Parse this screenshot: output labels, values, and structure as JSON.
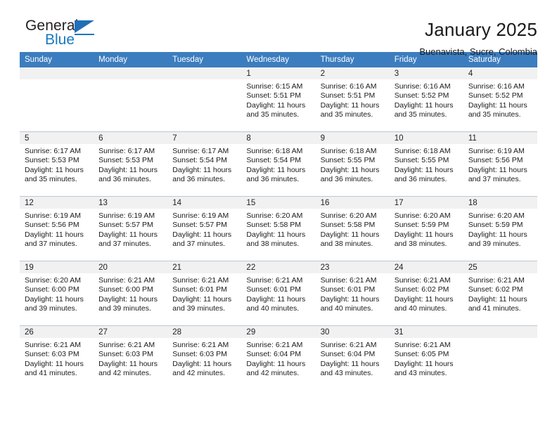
{
  "brand": {
    "name_line1": "General",
    "name_line2": "Blue",
    "triangle_color": "#1f6fb8",
    "blue_color": "#1878be"
  },
  "header": {
    "title": "January 2025",
    "subtitle": "Buenavista, Sucre, Colombia"
  },
  "theme": {
    "header_blue": "#3c7dbf",
    "daynum_bg": "#f1f1f1",
    "grid_line": "#b9c8d6"
  },
  "weekday_headers": [
    "Sunday",
    "Monday",
    "Tuesday",
    "Wednesday",
    "Thursday",
    "Friday",
    "Saturday"
  ],
  "weeks": [
    [
      {
        "day": "",
        "sunrise": "",
        "sunset": "",
        "daylight": "",
        "daylight2": ""
      },
      {
        "day": "",
        "sunrise": "",
        "sunset": "",
        "daylight": "",
        "daylight2": ""
      },
      {
        "day": "",
        "sunrise": "",
        "sunset": "",
        "daylight": "",
        "daylight2": ""
      },
      {
        "day": "1",
        "sunrise": "Sunrise: 6:15 AM",
        "sunset": "Sunset: 5:51 PM",
        "daylight": "Daylight: 11 hours",
        "daylight2": "and 35 minutes."
      },
      {
        "day": "2",
        "sunrise": "Sunrise: 6:16 AM",
        "sunset": "Sunset: 5:51 PM",
        "daylight": "Daylight: 11 hours",
        "daylight2": "and 35 minutes."
      },
      {
        "day": "3",
        "sunrise": "Sunrise: 6:16 AM",
        "sunset": "Sunset: 5:52 PM",
        "daylight": "Daylight: 11 hours",
        "daylight2": "and 35 minutes."
      },
      {
        "day": "4",
        "sunrise": "Sunrise: 6:16 AM",
        "sunset": "Sunset: 5:52 PM",
        "daylight": "Daylight: 11 hours",
        "daylight2": "and 35 minutes."
      }
    ],
    [
      {
        "day": "5",
        "sunrise": "Sunrise: 6:17 AM",
        "sunset": "Sunset: 5:53 PM",
        "daylight": "Daylight: 11 hours",
        "daylight2": "and 35 minutes."
      },
      {
        "day": "6",
        "sunrise": "Sunrise: 6:17 AM",
        "sunset": "Sunset: 5:53 PM",
        "daylight": "Daylight: 11 hours",
        "daylight2": "and 36 minutes."
      },
      {
        "day": "7",
        "sunrise": "Sunrise: 6:17 AM",
        "sunset": "Sunset: 5:54 PM",
        "daylight": "Daylight: 11 hours",
        "daylight2": "and 36 minutes."
      },
      {
        "day": "8",
        "sunrise": "Sunrise: 6:18 AM",
        "sunset": "Sunset: 5:54 PM",
        "daylight": "Daylight: 11 hours",
        "daylight2": "and 36 minutes."
      },
      {
        "day": "9",
        "sunrise": "Sunrise: 6:18 AM",
        "sunset": "Sunset: 5:55 PM",
        "daylight": "Daylight: 11 hours",
        "daylight2": "and 36 minutes."
      },
      {
        "day": "10",
        "sunrise": "Sunrise: 6:18 AM",
        "sunset": "Sunset: 5:55 PM",
        "daylight": "Daylight: 11 hours",
        "daylight2": "and 36 minutes."
      },
      {
        "day": "11",
        "sunrise": "Sunrise: 6:19 AM",
        "sunset": "Sunset: 5:56 PM",
        "daylight": "Daylight: 11 hours",
        "daylight2": "and 37 minutes."
      }
    ],
    [
      {
        "day": "12",
        "sunrise": "Sunrise: 6:19 AM",
        "sunset": "Sunset: 5:56 PM",
        "daylight": "Daylight: 11 hours",
        "daylight2": "and 37 minutes."
      },
      {
        "day": "13",
        "sunrise": "Sunrise: 6:19 AM",
        "sunset": "Sunset: 5:57 PM",
        "daylight": "Daylight: 11 hours",
        "daylight2": "and 37 minutes."
      },
      {
        "day": "14",
        "sunrise": "Sunrise: 6:19 AM",
        "sunset": "Sunset: 5:57 PM",
        "daylight": "Daylight: 11 hours",
        "daylight2": "and 37 minutes."
      },
      {
        "day": "15",
        "sunrise": "Sunrise: 6:20 AM",
        "sunset": "Sunset: 5:58 PM",
        "daylight": "Daylight: 11 hours",
        "daylight2": "and 38 minutes."
      },
      {
        "day": "16",
        "sunrise": "Sunrise: 6:20 AM",
        "sunset": "Sunset: 5:58 PM",
        "daylight": "Daylight: 11 hours",
        "daylight2": "and 38 minutes."
      },
      {
        "day": "17",
        "sunrise": "Sunrise: 6:20 AM",
        "sunset": "Sunset: 5:59 PM",
        "daylight": "Daylight: 11 hours",
        "daylight2": "and 38 minutes."
      },
      {
        "day": "18",
        "sunrise": "Sunrise: 6:20 AM",
        "sunset": "Sunset: 5:59 PM",
        "daylight": "Daylight: 11 hours",
        "daylight2": "and 39 minutes."
      }
    ],
    [
      {
        "day": "19",
        "sunrise": "Sunrise: 6:20 AM",
        "sunset": "Sunset: 6:00 PM",
        "daylight": "Daylight: 11 hours",
        "daylight2": "and 39 minutes."
      },
      {
        "day": "20",
        "sunrise": "Sunrise: 6:21 AM",
        "sunset": "Sunset: 6:00 PM",
        "daylight": "Daylight: 11 hours",
        "daylight2": "and 39 minutes."
      },
      {
        "day": "21",
        "sunrise": "Sunrise: 6:21 AM",
        "sunset": "Sunset: 6:01 PM",
        "daylight": "Daylight: 11 hours",
        "daylight2": "and 39 minutes."
      },
      {
        "day": "22",
        "sunrise": "Sunrise: 6:21 AM",
        "sunset": "Sunset: 6:01 PM",
        "daylight": "Daylight: 11 hours",
        "daylight2": "and 40 minutes."
      },
      {
        "day": "23",
        "sunrise": "Sunrise: 6:21 AM",
        "sunset": "Sunset: 6:01 PM",
        "daylight": "Daylight: 11 hours",
        "daylight2": "and 40 minutes."
      },
      {
        "day": "24",
        "sunrise": "Sunrise: 6:21 AM",
        "sunset": "Sunset: 6:02 PM",
        "daylight": "Daylight: 11 hours",
        "daylight2": "and 40 minutes."
      },
      {
        "day": "25",
        "sunrise": "Sunrise: 6:21 AM",
        "sunset": "Sunset: 6:02 PM",
        "daylight": "Daylight: 11 hours",
        "daylight2": "and 41 minutes."
      }
    ],
    [
      {
        "day": "26",
        "sunrise": "Sunrise: 6:21 AM",
        "sunset": "Sunset: 6:03 PM",
        "daylight": "Daylight: 11 hours",
        "daylight2": "and 41 minutes."
      },
      {
        "day": "27",
        "sunrise": "Sunrise: 6:21 AM",
        "sunset": "Sunset: 6:03 PM",
        "daylight": "Daylight: 11 hours",
        "daylight2": "and 42 minutes."
      },
      {
        "day": "28",
        "sunrise": "Sunrise: 6:21 AM",
        "sunset": "Sunset: 6:03 PM",
        "daylight": "Daylight: 11 hours",
        "daylight2": "and 42 minutes."
      },
      {
        "day": "29",
        "sunrise": "Sunrise: 6:21 AM",
        "sunset": "Sunset: 6:04 PM",
        "daylight": "Daylight: 11 hours",
        "daylight2": "and 42 minutes."
      },
      {
        "day": "30",
        "sunrise": "Sunrise: 6:21 AM",
        "sunset": "Sunset: 6:04 PM",
        "daylight": "Daylight: 11 hours",
        "daylight2": "and 43 minutes."
      },
      {
        "day": "31",
        "sunrise": "Sunrise: 6:21 AM",
        "sunset": "Sunset: 6:05 PM",
        "daylight": "Daylight: 11 hours",
        "daylight2": "and 43 minutes."
      },
      {
        "day": "",
        "sunrise": "",
        "sunset": "",
        "daylight": "",
        "daylight2": ""
      }
    ]
  ]
}
